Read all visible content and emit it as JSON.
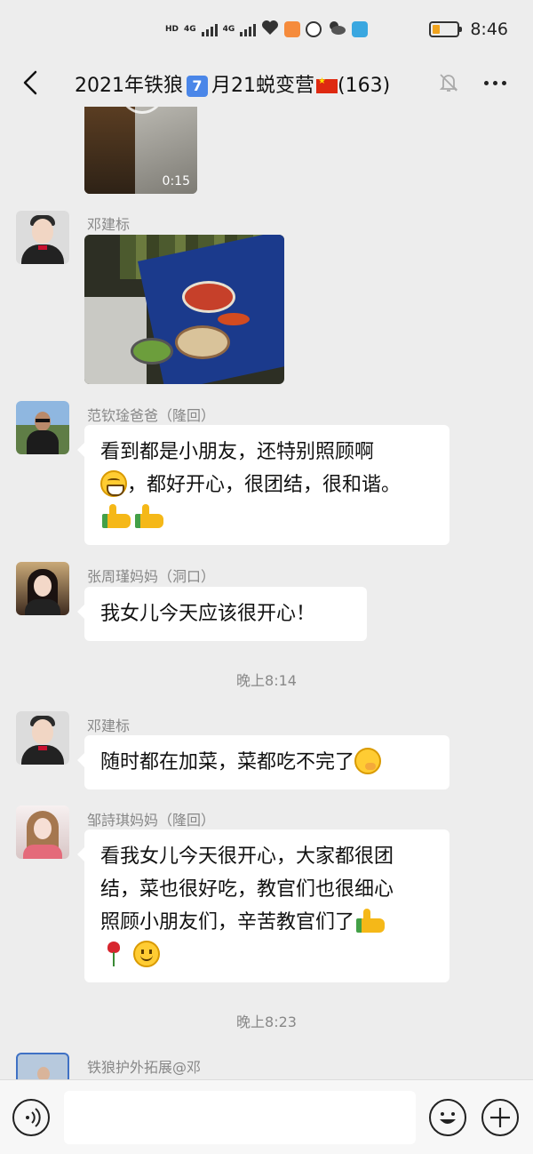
{
  "status_bar": {
    "time": "8:46",
    "battery_level": 0.3,
    "network_labels": [
      "HD",
      "4G",
      "4G"
    ],
    "icons": [
      "hd-icon",
      "signal-4g-icon",
      "signal-4g-icon",
      "heart-rate-icon",
      "health-app-icon",
      "shield-app-icon",
      "weather-icon",
      "notes-app-icon",
      "battery-icon"
    ]
  },
  "header": {
    "title_prefix": "2021年铁狼",
    "title_badge": "7",
    "title_middle": "月21蜕变营",
    "title_suffix": "(163)",
    "icons": [
      "back-icon",
      "china-flag-icon",
      "mute-bell-icon",
      "more-icon"
    ]
  },
  "messages": [
    {
      "type": "video",
      "duration": "0:15"
    },
    {
      "type": "image",
      "sender": "邓建标",
      "avatar": "avatar-deng"
    },
    {
      "type": "text",
      "sender": "范钦琻爸爸（隆回）",
      "line1": "看到都是小朋友，还特别照顾啊",
      "line2": "，都好开心，很团结，很和谐。",
      "emojis": [
        "grin-emoji",
        "thumbs-up-emoji",
        "thumbs-up-emoji"
      ]
    },
    {
      "type": "text",
      "sender": "张周瑾妈妈（洞口）",
      "line1": "我女儿今天应该很开心！"
    },
    {
      "type": "time",
      "text": "晚上8:14"
    },
    {
      "type": "text",
      "sender": "邓建标",
      "line1": "随时都在加菜，菜都吃不完了",
      "emojis": [
        "thinking-emoji"
      ]
    },
    {
      "type": "text",
      "sender": "邹詩琪妈妈（隆回）",
      "line1": "看我女儿今天很开心，大家都很团",
      "line2": "结，菜也很好吃，教官们也很细心",
      "line3": "照顾小朋友们，辛苦教官们了",
      "emojis": [
        "thumbs-up-emoji",
        "rose-emoji",
        "smile-emoji"
      ]
    },
    {
      "type": "time",
      "text": "晚上8:23"
    },
    {
      "type": "text",
      "sender": "铁狼护外拓展@邓"
    }
  ],
  "input_bar": {
    "placeholder": "",
    "icons": [
      "voice-icon",
      "emoji-icon",
      "plus-icon"
    ]
  },
  "colors": {
    "background": "#ededed",
    "bubble": "#ffffff",
    "secondary_text": "#888888",
    "battery": "#f0a31e"
  }
}
